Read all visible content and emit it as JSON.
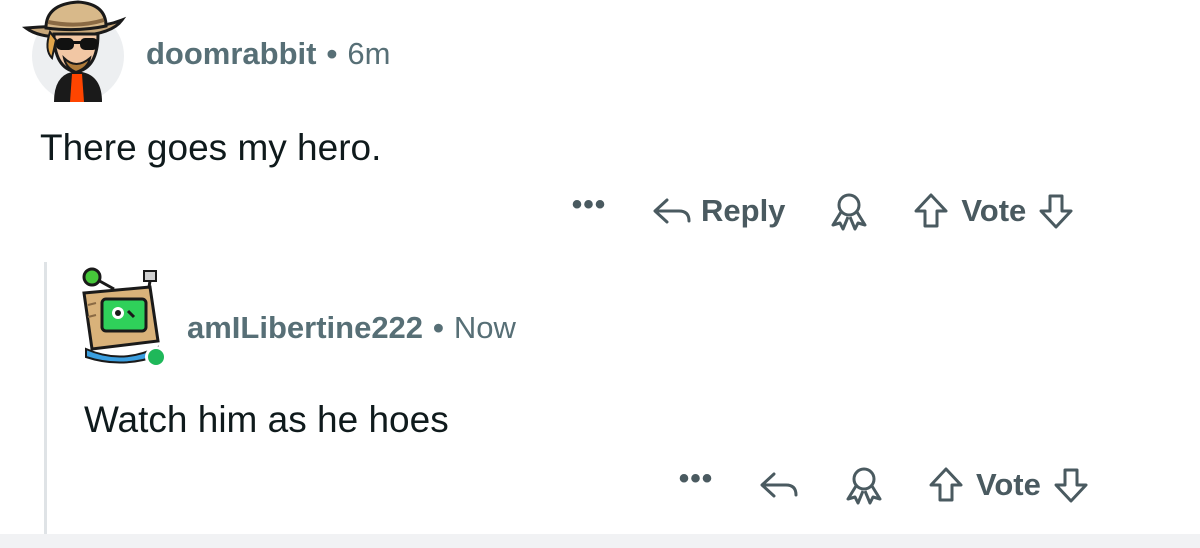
{
  "comments": [
    {
      "username": "doomrabbit",
      "separator": "•",
      "time": "6m",
      "body": "There goes my hero.",
      "actions": {
        "more_label": "•••",
        "reply_label": "Reply",
        "vote_label": "Vote"
      },
      "avatar_icon": "cowboy-sunglasses-avatar-icon"
    },
    {
      "username": "amILibertine222",
      "separator": "•",
      "time": "Now",
      "body": "Watch him as he hoes",
      "actions": {
        "more_label": "•••",
        "vote_label": "Vote"
      },
      "avatar_icon": "box-robot-avatar-icon",
      "online_status_color": "#1fb85a"
    }
  ],
  "colors": {
    "meta_text": "#576f76",
    "body_text": "#0f1a1c",
    "action_icon": "#4a5a60",
    "thread_line": "#dfe3e6"
  }
}
